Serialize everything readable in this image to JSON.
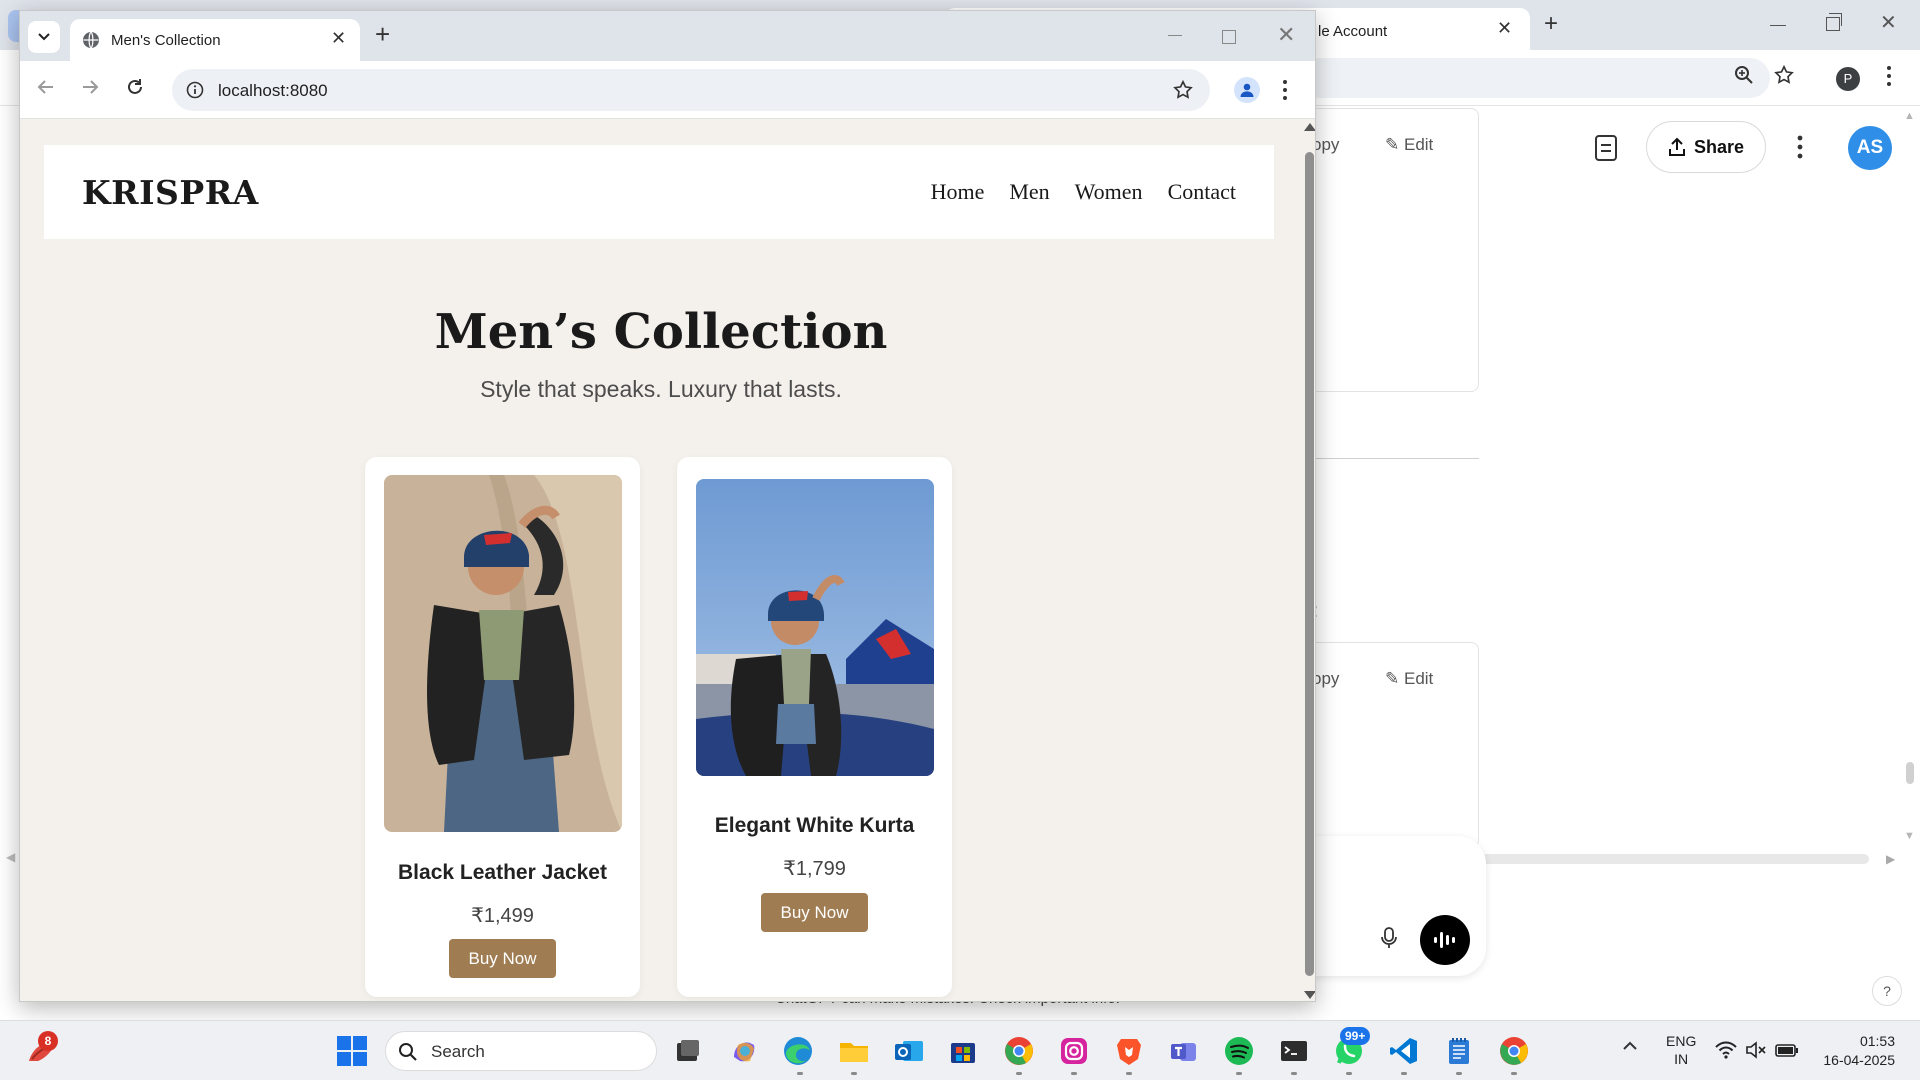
{
  "background_window": {
    "tab_title": "le Account",
    "share_label": "Share",
    "avatar_initials": "AS",
    "profile_initial": "P",
    "copy_label": "opy",
    "edit_label": "Edit",
    "colon_text": "l:",
    "disclaimer": "ChatGPT can make mistakes. Check important info.",
    "help_label": "?"
  },
  "browser": {
    "tab_title": "Men's Collection",
    "url": "localhost:8080"
  },
  "site": {
    "logo": "KRISPRA",
    "nav": [
      "Home",
      "Men",
      "Women",
      "Contact"
    ],
    "hero_title": "Men’s Collection",
    "hero_subtitle": "Style that speaks. Luxury that lasts.",
    "button_color": "#a07c52",
    "products": [
      {
        "name": "Black Leather Jacket",
        "price": "₹1,499",
        "button": "Buy Now"
      },
      {
        "name": "Elegant White Kurta",
        "price": "₹1,799",
        "button": "Buy Now"
      }
    ]
  },
  "taskbar": {
    "weather_badge": "8",
    "search_label": "Search",
    "whatsapp_badge": "99+",
    "language_line1": "ENG",
    "language_line2": "IN",
    "time": "01:53",
    "date": "16-04-2025"
  }
}
